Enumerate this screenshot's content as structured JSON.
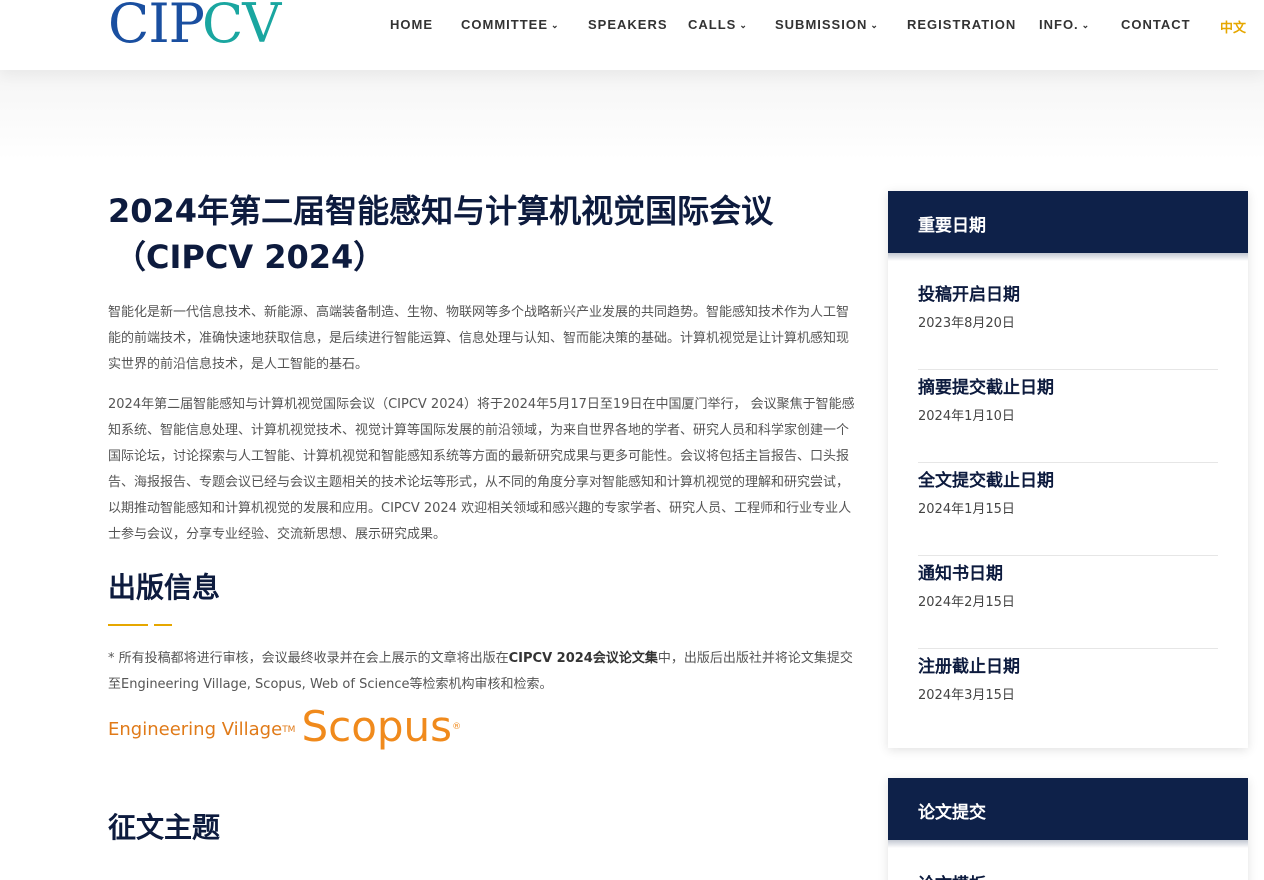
{
  "brand": {
    "logo_text_1": "CIP",
    "logo_text_2": "CV"
  },
  "nav": {
    "items": [
      {
        "label": "HOME",
        "dropdown": false
      },
      {
        "label": "COMMITTEE",
        "dropdown": true
      },
      {
        "label": "SPEAKERS",
        "dropdown": false
      },
      {
        "label": "CALLS",
        "dropdown": true
      },
      {
        "label": "SUBMISSION",
        "dropdown": true
      },
      {
        "label": "REGISTRATION",
        "dropdown": false
      },
      {
        "label": "INFO.",
        "dropdown": true
      },
      {
        "label": "CONTACT",
        "dropdown": false
      }
    ],
    "lang": "中文",
    "caret": "❯"
  },
  "main": {
    "title_line1": "2024年第二届智能感知与计算机视觉国际会议",
    "title_line2": "（CIPCV 2024）",
    "para1": "智能化是新一代信息技术、新能源、高端装备制造、生物、物联网等多个战略新兴产业发展的共同趋势。智能感知技术作为人工智能的前端技术，准确快速地获取信息，是后续进行智能运算、信息处理与认知、智而能决策的基础。计算机视觉是让计算机感知现实世界的前沿信息技术，是人工智能的基石。",
    "para2": "2024年第二届智能感知与计算机视觉国际会议（CIPCV 2024）将于2024年5月17日至19日在中国厦门举行， 会议聚焦于智能感知系统、智能信息处理、计算机视觉技术、视觉计算等国际发展的前沿领域，为来自世界各地的学者、研究人员和科学家创建一个国际论坛，讨论探索与人工智能、计算机视觉和智能感知系统等方面的最新研究成果与更多可能性。会议将包括主旨报告、口头报告、海报报告、专题会议已经与会议主题相关的技术论坛等形式，从不同的角度分享对智能感知和计算机视觉的理解和研究尝试，以期推动智能感知和计算机视觉的发展和应用。CIPCV 2024 欢迎相关领域和感兴趣的专家学者、研究人员、工程师和行业专业人士参与会议，分享专业经验、交流新思想、展示研究成果。",
    "pub_heading": "出版信息",
    "note_before": "* 所有投稿都将进行审核，会议最终收录并在会上展示的文章将出版在",
    "note_bold": "CIPCV 2024会议论文集",
    "note_after": "中，出版后出版社并将论文集提交至Engineering Village, Scopus, Web of Science等检索机构审核和检索。",
    "ev_logo": "Engineering Village",
    "tm": "TM",
    "scopus_logo": "Scopus",
    "reg": "®",
    "topics_heading": "征文主题"
  },
  "sidebar": {
    "dates_title": "重要日期",
    "dates": [
      {
        "title": "投稿开启日期",
        "date": "2023年8月20日"
      },
      {
        "title": "摘要提交截止日期",
        "date": "2024年1月10日"
      },
      {
        "title": "全文提交截止日期",
        "date": "2024年1月15日"
      },
      {
        "title": "通知书日期",
        "date": "2024年2月15日"
      },
      {
        "title": "注册截止日期",
        "date": "2024年3月15日"
      }
    ],
    "submit_title": "论文提交",
    "submit_first_item": "论文模板"
  },
  "colors": {
    "navy": "#0e2149",
    "accent": "#e6a700",
    "logo_blue": "#1a4fa0",
    "logo_teal": "#1aa6a0"
  }
}
